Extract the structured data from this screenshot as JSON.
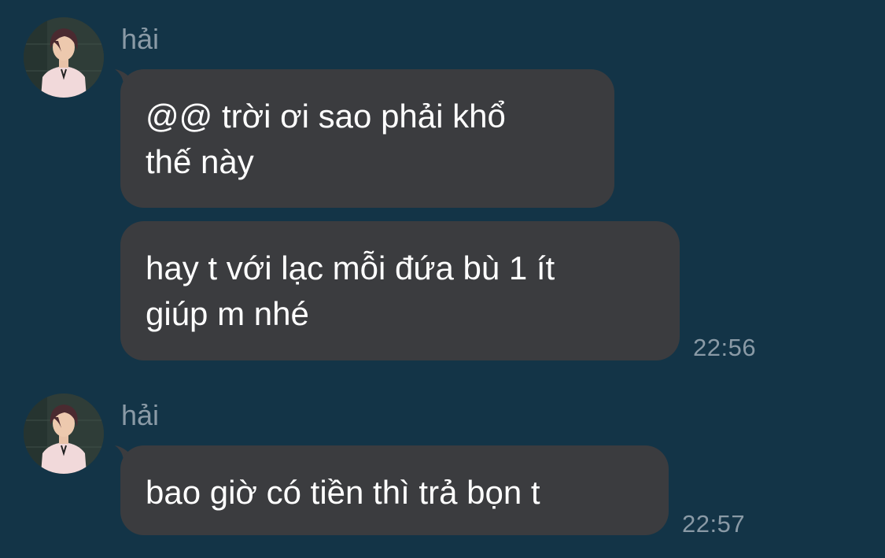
{
  "messages": [
    {
      "sender": "hải",
      "avatar_icon": "profile-photo",
      "bubbles": [
        {
          "lines": [
            "@@ trời ơi sao phải khổ",
            "thế này"
          ]
        },
        {
          "lines": [
            "hay t với lạc mỗi đứa bù 1 ít",
            "giúp m nhé"
          ],
          "time": "22:56"
        }
      ]
    },
    {
      "sender": "hải",
      "avatar_icon": "profile-photo",
      "bubbles": [
        {
          "lines": [
            "bao giờ có tiền thì trả bọn t"
          ],
          "time": "22:57"
        }
      ]
    }
  ],
  "colors": {
    "background": "#133447",
    "bubble": "#3b3c3f",
    "meta_text": "#8a9aa6",
    "message_text": "#ffffff"
  }
}
